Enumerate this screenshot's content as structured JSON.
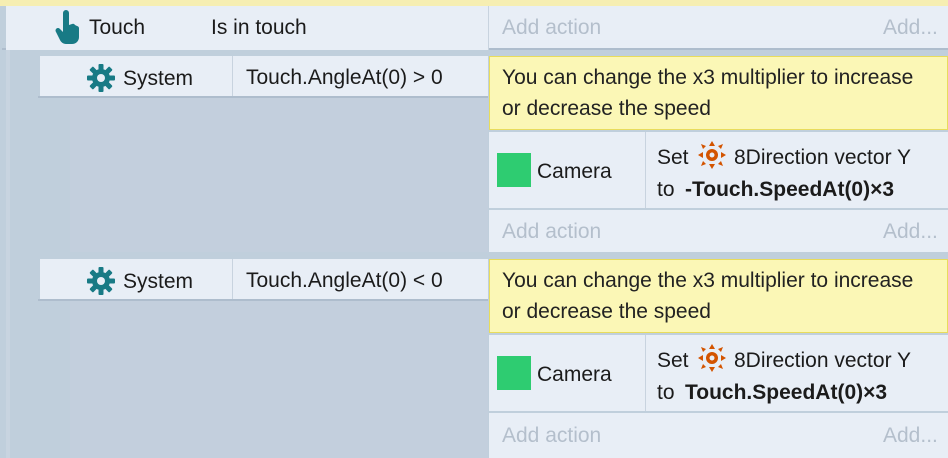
{
  "events": [
    {
      "object": "Touch",
      "icon": "hand-touch-icon",
      "condition": "Is in touch",
      "add_action": "Add action",
      "add_more": "Add..."
    }
  ],
  "subevents": [
    {
      "object": "System",
      "icon": "gear-icon",
      "condition": "Touch.AngleAt(0) > 0",
      "comment": "You can change the x3 multiplier to increase or decrease the speed",
      "action_object": "Camera",
      "action_set": "Set",
      "action_target": "8Direction vector Y",
      "action_to": "to",
      "action_value": "-Touch.SpeedAt(0)×3",
      "add_action": "Add action",
      "add_more": "Add..."
    },
    {
      "object": "System",
      "icon": "gear-icon",
      "condition": "Touch.AngleAt(0) < 0",
      "comment": "You can change the x3 multiplier to increase or decrease the speed",
      "action_object": "Camera",
      "action_set": "Set",
      "action_target": "8Direction vector Y",
      "action_to": "to",
      "action_value": "Touch.SpeedAt(0)×3",
      "add_action": "Add action",
      "add_more": "Add..."
    }
  ],
  "colors": {
    "camera_square": "#2ecc71",
    "comment_bg": "#fbf7b6",
    "icon_teal": "#187a85",
    "eightdir_icon": "#d35400"
  }
}
